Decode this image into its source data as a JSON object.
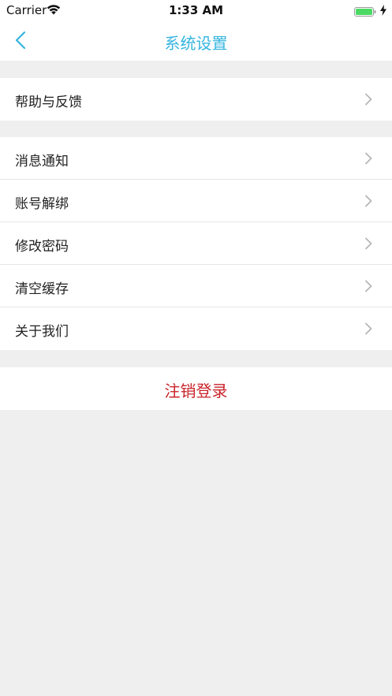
{
  "status_bar": {
    "carrier": "Carrier",
    "time": "1:33 AM",
    "battery_level": 1.0,
    "battery_color": "#4cd964"
  },
  "nav": {
    "title": "系统设置",
    "back_icon": "chevron-left-icon",
    "accent_color": "#35b5df"
  },
  "groups": [
    {
      "items": [
        {
          "label": "帮助与反馈"
        }
      ]
    },
    {
      "items": [
        {
          "label": "消息通知"
        },
        {
          "label": "账号解绑"
        },
        {
          "label": "修改密码"
        },
        {
          "label": "清空缓存"
        },
        {
          "label": "关于我们"
        }
      ]
    }
  ],
  "logout": {
    "label": "注销登录",
    "color": "#c9242b"
  }
}
